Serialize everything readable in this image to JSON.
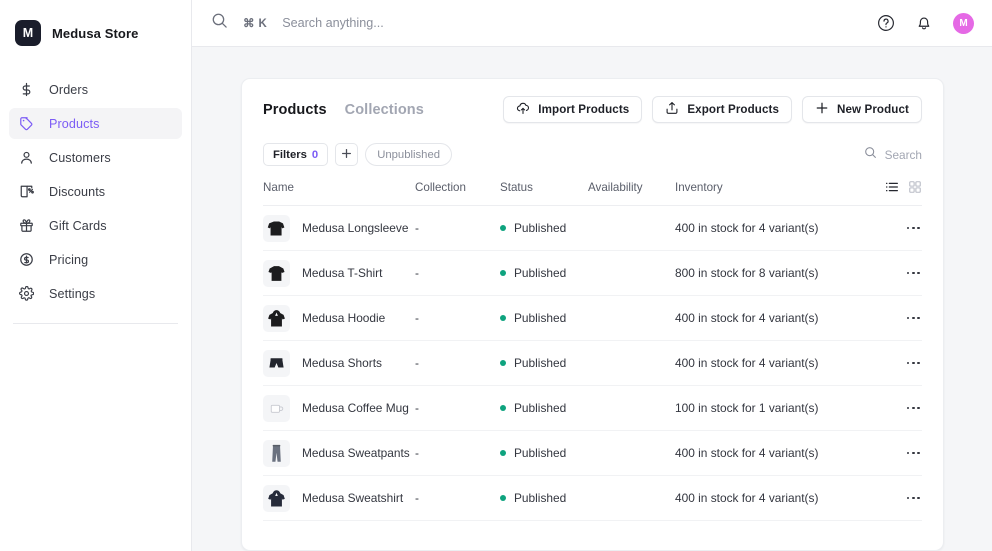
{
  "brand": {
    "logo_letter": "M",
    "name": "Medusa Store"
  },
  "sidebar": {
    "items": [
      {
        "label": "Orders",
        "icon": "dollar-icon",
        "active": false
      },
      {
        "label": "Products",
        "icon": "tag-icon",
        "active": true
      },
      {
        "label": "Customers",
        "icon": "user-icon",
        "active": false
      },
      {
        "label": "Discounts",
        "icon": "discount-icon",
        "active": false
      },
      {
        "label": "Gift Cards",
        "icon": "gift-icon",
        "active": false
      },
      {
        "label": "Pricing",
        "icon": "pricing-icon",
        "active": false
      },
      {
        "label": "Settings",
        "icon": "gear-icon",
        "active": false
      }
    ]
  },
  "topbar": {
    "search_shortcut": "⌘ K",
    "search_placeholder": "Search anything...",
    "help_icon": "help-circle-icon",
    "notifications_icon": "bell-icon",
    "avatar_letter": "M"
  },
  "page": {
    "tabs": [
      {
        "label": "Products",
        "active": true
      },
      {
        "label": "Collections",
        "active": false
      }
    ],
    "buttons": [
      {
        "label": "Import Products",
        "icon": "cloud-upload-icon"
      },
      {
        "label": "Export Products",
        "icon": "export-icon"
      },
      {
        "label": "New Product",
        "icon": "plus-icon"
      }
    ],
    "filters": {
      "label": "Filters",
      "count": "0",
      "add_label": "+",
      "chips": [
        "Unpublished"
      ]
    },
    "table_search": {
      "icon": "search-icon",
      "label": "Search"
    },
    "view_modes": [
      {
        "name": "list-view",
        "active": true
      },
      {
        "name": "grid-view",
        "active": false
      }
    ]
  },
  "table": {
    "columns": [
      "Name",
      "Collection",
      "Status",
      "Availability",
      "Inventory"
    ],
    "status_color": "#0ea37e",
    "rows": [
      {
        "name": "Medusa Longsleeve",
        "thumb": "longsleeve-thumb",
        "collection": "-",
        "status": "Published",
        "availability": "",
        "inventory": "400 in stock for 4 variant(s)"
      },
      {
        "name": "Medusa T-Shirt",
        "thumb": "tshirt-thumb",
        "collection": "-",
        "status": "Published",
        "availability": "",
        "inventory": "800 in stock for 8 variant(s)"
      },
      {
        "name": "Medusa Hoodie",
        "thumb": "hoodie-thumb",
        "collection": "-",
        "status": "Published",
        "availability": "",
        "inventory": "400 in stock for 4 variant(s)"
      },
      {
        "name": "Medusa Shorts",
        "thumb": "shorts-thumb",
        "collection": "-",
        "status": "Published",
        "availability": "",
        "inventory": "400 in stock for 4 variant(s)"
      },
      {
        "name": "Medusa Coffee Mug",
        "thumb": "mug-thumb",
        "collection": "-",
        "status": "Published",
        "availability": "",
        "inventory": "100 in stock for 1 variant(s)"
      },
      {
        "name": "Medusa Sweatpants",
        "thumb": "sweatpants-thumb",
        "collection": "-",
        "status": "Published",
        "availability": "",
        "inventory": "400 in stock for 4 variant(s)"
      },
      {
        "name": "Medusa Sweatshirt",
        "thumb": "sweatshirt-thumb",
        "collection": "-",
        "status": "Published",
        "availability": "",
        "inventory": "400 in stock for 4 variant(s)"
      }
    ],
    "row_menu_icon": "more-horizontal-icon"
  },
  "colors": {
    "accent": "#7c5cf5",
    "status_published": "#0ea37e",
    "avatar": "#e569e5",
    "logo_bg": "#1a1d2b"
  }
}
